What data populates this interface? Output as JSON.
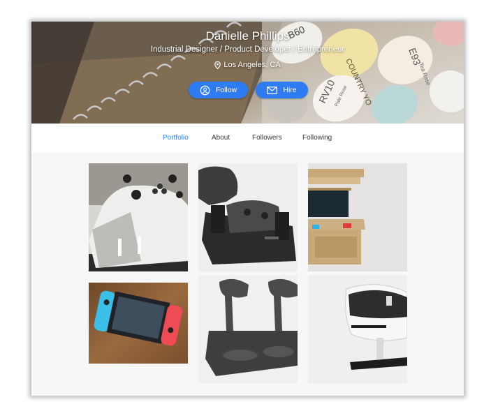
{
  "profile": {
    "name": "Danielle Phillips",
    "tagline": "Industrial Designer / Product Developer / Entrepreneur",
    "location": "Los Angeles, CA"
  },
  "actions": {
    "follow_label": "Follow",
    "hire_label": "Hire"
  },
  "tabs": [
    {
      "label": "Portfolio",
      "active": true
    },
    {
      "label": "About",
      "active": false
    },
    {
      "label": "Followers",
      "active": false
    },
    {
      "label": "Following",
      "active": false
    }
  ],
  "hero": {
    "marker_caps": [
      "B60",
      "COUNTRY YO",
      "E93",
      "RV10",
      "Tea Rose",
      "Pale Rose"
    ]
  },
  "portfolio_items": [
    {
      "subject": "controller-charging-dock"
    },
    {
      "subject": "controller-stand"
    },
    {
      "subject": "cardboard-arcade-cabinet"
    },
    {
      "subject": "handheld-console"
    },
    {
      "subject": "vr-controller-dock"
    },
    {
      "subject": "vr-headset-stand"
    }
  ],
  "colors": {
    "accent": "#2f7bf2",
    "tab_text": "#3b3b3b",
    "page_bg": "#f7f7f8"
  }
}
